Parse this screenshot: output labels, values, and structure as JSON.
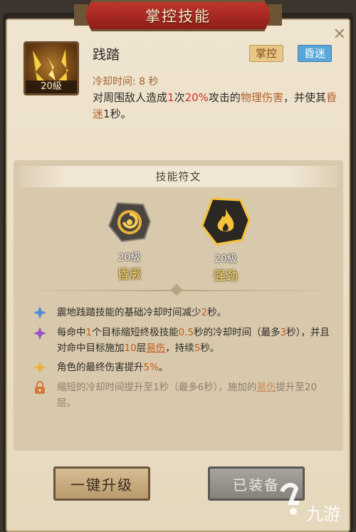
{
  "header": {
    "title": "掌控技能"
  },
  "skill": {
    "name": "践踏",
    "level_badge": "20級",
    "tags": [
      "掌控",
      "昏迷"
    ],
    "cooldown": "冷却时间: 8 秒",
    "desc": {
      "p1": "对周围敌人造成",
      "hits": "1",
      "p2": "次",
      "percent": "20%",
      "p3": "攻击的",
      "damage_type": "物理伤害",
      "p4": "，并使其",
      "status": "昏迷",
      "duration": "1",
      "p5": "秒。"
    }
  },
  "runes": {
    "title": "技能符文",
    "items": [
      {
        "level": "20級",
        "name": "昏厥",
        "icon": "swirl-rune-icon"
      },
      {
        "level": "20級",
        "name": "强劲",
        "icon": "flame-rune-icon"
      }
    ]
  },
  "effects": [
    {
      "icon": "blue-star-icon",
      "parts": [
        "震地践踏技能的基础冷却时间减少",
        "2",
        "秒。"
      ]
    },
    {
      "icon": "purple-star-icon",
      "parts": [
        "每命中",
        "1",
        "个目标缩短终极技能",
        "0.5",
        "秒的冷却时间（最多",
        "3",
        "秒），并且对命中目标施加",
        "10",
        "层",
        "易伤",
        "，持续",
        "5",
        "秒。"
      ]
    },
    {
      "icon": "gold-star-icon",
      "parts": [
        "角色的最终伤害提升",
        "5%",
        "。"
      ]
    },
    {
      "icon": "lock-icon",
      "parts": [
        "缩短的冷却时间提升至",
        "1",
        "秒（最多",
        "6",
        "秒），施加的",
        "易伤",
        "提升至",
        "20",
        "层。"
      ]
    }
  ],
  "buttons": {
    "upgrade": "一键升级",
    "equipped": "已装备"
  },
  "colors": {
    "red": "#d22e22",
    "accent": "#b0612a",
    "tag_blue": "#5aa6d8"
  }
}
